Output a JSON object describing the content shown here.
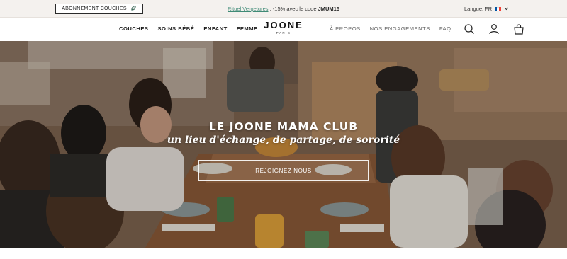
{
  "topbar": {
    "subscribe_label": "ABONNEMENT COUCHES",
    "subscribe_icon": "leaf-icon",
    "promo_link": "Rituel Vergetures",
    "promo_text": " : -15% avec le code ",
    "promo_code": "JMUM15",
    "language_label": "Langue: FR",
    "flag_colors": [
      "#0055a4",
      "#ffffff",
      "#ef4135"
    ]
  },
  "nav": {
    "left_items": [
      "COUCHES",
      "SOINS BÉBÉ",
      "ENFANT",
      "FEMME"
    ],
    "logo": "JOONE",
    "logo_sub": "PARIS",
    "right_items": [
      "À PROPOS",
      "NOS ENGAGEMENTS",
      "FAQ"
    ],
    "icons": [
      "search-icon",
      "account-icon",
      "cart-icon"
    ]
  },
  "hero": {
    "title": "LE JOONE MAMA CLUB",
    "subtitle": "un lieu d'échange, de partage, de sororité",
    "cta_label": "REJOIGNEZ NOUS"
  },
  "colors": {
    "promo_link": "#3f8a76",
    "topbar_bg": "#f4f1ee"
  }
}
